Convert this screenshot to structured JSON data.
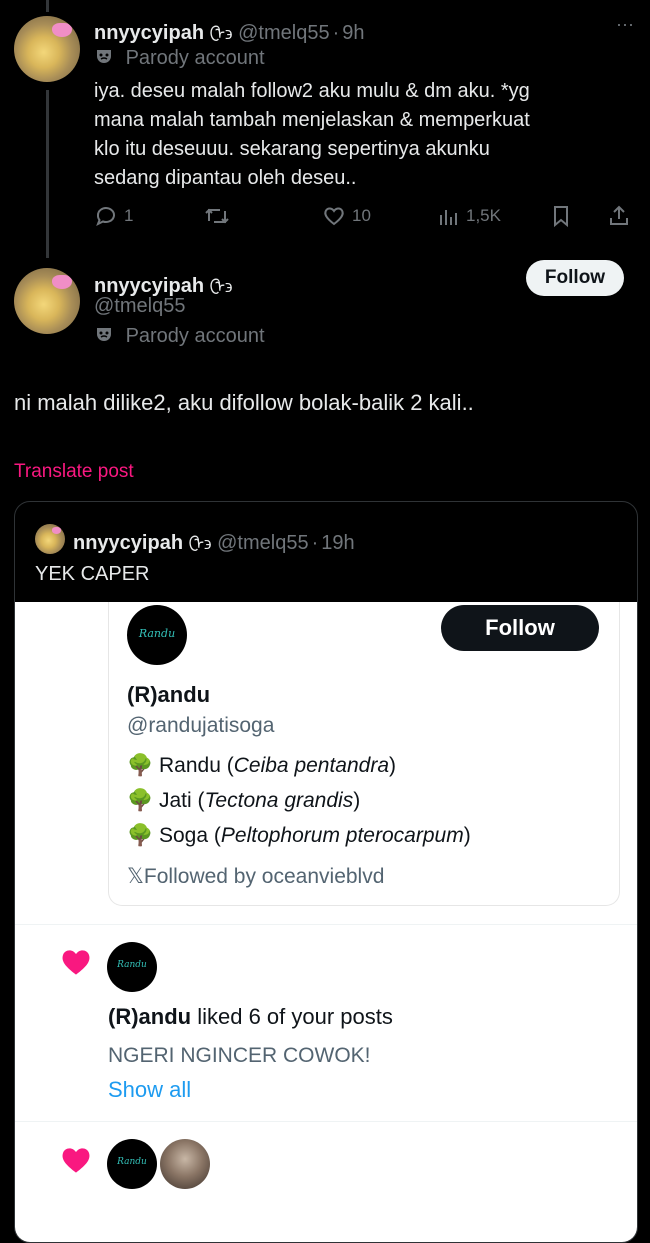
{
  "parent_post": {
    "display_name": "nnyycyipah",
    "name_glyph": "ᠿ϶",
    "handle": "@tmelq55",
    "separator": "·",
    "time": "9h",
    "parody_label": "Parody account",
    "text_lines": [
      "iya. deseu malah follow2 aku mulu & dm aku. *yg",
      "mana malah tambah menjelaskan & memperkuat",
      "klo itu deseuuu. sekarang sepertinya akunku",
      "sedang dipantau oleh deseu.."
    ],
    "more": "···",
    "actions": {
      "replies": "1",
      "likes": "10",
      "views": "1,5K"
    }
  },
  "main_post": {
    "display_name": "nnyycyipah",
    "name_glyph": "ᠿ϶",
    "handle": "@tmelq55",
    "parody_label": "Parody account",
    "follow_label": "Follow",
    "text": "ni malah dilike2, aku difollow bolak-balik 2 kali..",
    "translate_label": "Translate post"
  },
  "quoted_post": {
    "display_name": "nnyycyipah",
    "name_glyph": "ᠿ϶",
    "handle": "@tmelq55",
    "separator": "·",
    "time": "19h",
    "text": "YEK CAPER"
  },
  "profile_card": {
    "avatar_text": "Randu",
    "follow_label": "Follow",
    "name": "(R)andu",
    "handle": "@randujatisoga",
    "bio": [
      {
        "emoji": "🌳",
        "name": "Randu",
        "open": "(",
        "latin": "Ceiba pentandra",
        "close": ")"
      },
      {
        "emoji": "🌳",
        "name": "Jati",
        "open": "(",
        "latin": "Tectona grandis",
        "close": ")"
      },
      {
        "emoji": "🌳",
        "name": "Soga",
        "open": "(",
        "latin": "Peltophorum pterocarpum",
        "close": ")"
      }
    ],
    "x_glyph": "𝕏",
    "followed_by": "Followed by oceanvieblvd"
  },
  "notification": {
    "avatar_text": "Randu",
    "actor": "(R)andu",
    "action": "liked 6 of your posts",
    "post_preview": "NGERI NGINCER COWOK!",
    "show_all": "Show all"
  },
  "notification2": {
    "avatar_text": "Randu"
  },
  "colors": {
    "background": "#000000",
    "text": "#e7e9ea",
    "muted": "#71767b",
    "translate_pink": "#f91880",
    "like_heart": "#f91880",
    "link_blue": "#1d9bf0"
  }
}
